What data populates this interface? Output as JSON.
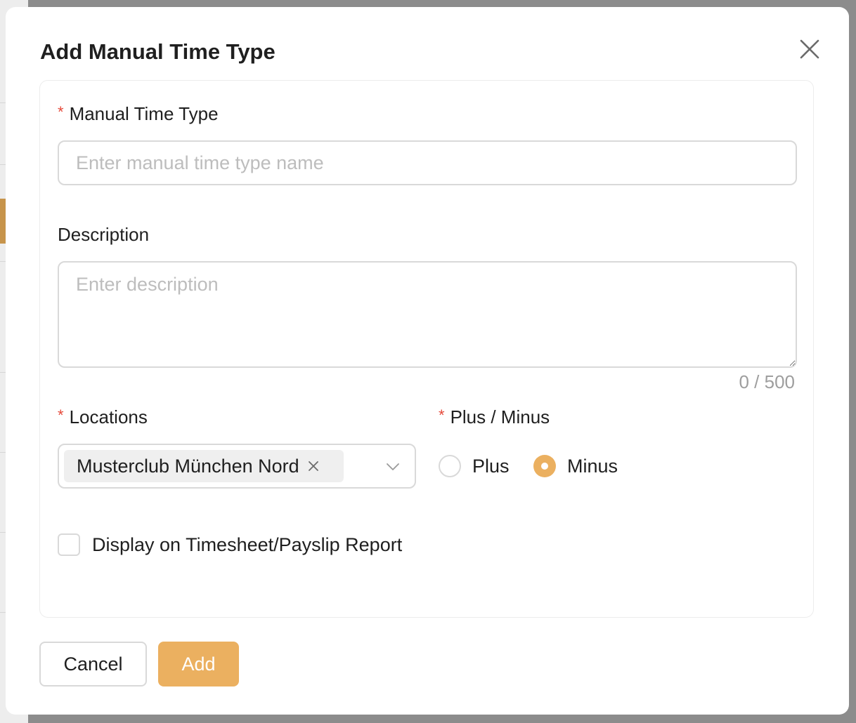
{
  "modal": {
    "title": "Add Manual Time Type",
    "close_icon": "close-icon"
  },
  "form": {
    "manual_time_type": {
      "label": "Manual Time Type",
      "required_mark": "*",
      "value": "",
      "placeholder": "Enter manual time type name"
    },
    "description": {
      "label": "Description",
      "value": "",
      "placeholder": "Enter description",
      "counter": "0 / 500"
    },
    "locations": {
      "label": "Locations",
      "required_mark": "*",
      "selected_tags": [
        "Musterclub München Nord"
      ],
      "dropdown_icon": "chevron-down-icon"
    },
    "plus_minus": {
      "label": "Plus / Minus",
      "required_mark": "*",
      "options": [
        "Plus",
        "Minus"
      ],
      "selected": "Minus"
    },
    "display_report": {
      "label": "Display on Timesheet/Payslip Report",
      "checked": false
    }
  },
  "footer": {
    "cancel_label": "Cancel",
    "add_label": "Add"
  },
  "colors": {
    "accent": "#ebb060",
    "required": "#e5493a",
    "border": "#d9d9d9",
    "placeholder": "#bdbdbd"
  }
}
